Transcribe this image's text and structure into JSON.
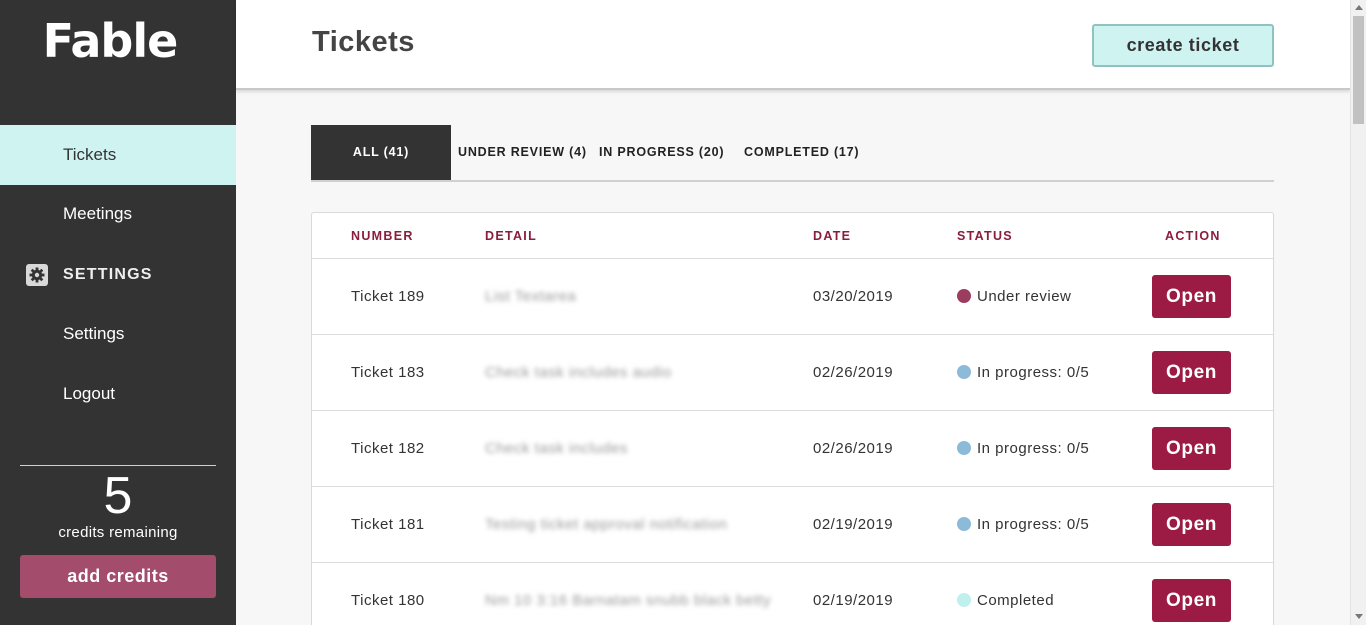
{
  "sidebar": {
    "logo": "Fable",
    "nav": {
      "tickets": "Tickets",
      "meetings": "Meetings",
      "settings_section": "SETTINGS",
      "settings": "Settings",
      "logout": "Logout"
    },
    "credits": {
      "count": "5",
      "label": "credits remaining",
      "button": "add credits"
    }
  },
  "header": {
    "title": "Tickets",
    "create_button": "create ticket"
  },
  "tabs": [
    {
      "label": "ALL (41)",
      "active": true
    },
    {
      "label": "UNDER REVIEW (4)",
      "active": false
    },
    {
      "label": "IN PROGRESS (20)",
      "active": false
    },
    {
      "label": "COMPLETED (17)",
      "active": false
    }
  ],
  "table": {
    "columns": {
      "number": "NUMBER",
      "detail": "DETAIL",
      "date": "DATE",
      "status": "STATUS",
      "action": "ACTION"
    },
    "rows": [
      {
        "number": "Ticket 189",
        "detail": "List Textarea",
        "date": "03/20/2019",
        "status": "Under review",
        "status_color": "#9b3d5f",
        "action": "Open"
      },
      {
        "number": "Ticket 183",
        "detail": "Check task includes audio",
        "date": "02/26/2019",
        "status": "In progress: 0/5",
        "status_color": "#8bbbd9",
        "action": "Open"
      },
      {
        "number": "Ticket 182",
        "detail": "Check task includes",
        "date": "02/26/2019",
        "status": "In progress: 0/5",
        "status_color": "#8bbbd9",
        "action": "Open"
      },
      {
        "number": "Ticket 181",
        "detail": "Testing ticket approval notification",
        "date": "02/19/2019",
        "status": "In progress: 0/5",
        "status_color": "#8bbbd9",
        "action": "Open"
      },
      {
        "number": "Ticket 180",
        "detail": "Nm 10 3:16 Barnatam snubb black betty",
        "date": "02/19/2019",
        "status": "Completed",
        "status_color": "#bff0ee",
        "action": "Open"
      }
    ]
  },
  "colors": {
    "sidebar_bg": "#333333",
    "accent_teal": "#cff3f1",
    "brand_maroon": "#9b1b45",
    "credits_button": "#a34c6c"
  }
}
